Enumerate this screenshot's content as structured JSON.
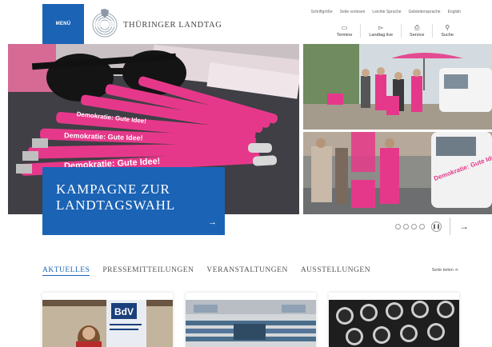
{
  "header": {
    "menu_label": "MENÜ",
    "logo_text": "THÜRINGER LANDTAG",
    "top_links": [
      "Schriftgröße",
      "Seite vorlesen",
      "Leichte Sprache",
      "Gebärdensprache",
      "English"
    ],
    "tools": [
      {
        "label": "Termine",
        "icon": "calendar-icon"
      },
      {
        "label": "Landtag live",
        "icon": "video-icon"
      },
      {
        "label": "Service",
        "icon": "document-icon"
      },
      {
        "label": "Suche",
        "icon": "search-icon"
      }
    ]
  },
  "hero": {
    "campaign_title_line1": "KAMPAGNE ZUR",
    "campaign_title_line2": "LANDTAGSWAHL",
    "pen_text": "Demokratie: Gute Idee!",
    "van_text": "Demokratie: Gute Idee!",
    "slide_count": 4,
    "accent": "#1b63b5",
    "pink": "#e6388a"
  },
  "tabs": [
    "AKTUELLES",
    "PRESSEMITTEILUNGEN",
    "VERANSTALTUNGEN",
    "AUSSTELLUNGEN"
  ],
  "share_label": "Seite teilen",
  "cards": [
    {
      "image": "conference-speaker",
      "sign_text": "BdV"
    },
    {
      "image": "plenary-hall"
    },
    {
      "image": "typewriter-keys"
    }
  ]
}
